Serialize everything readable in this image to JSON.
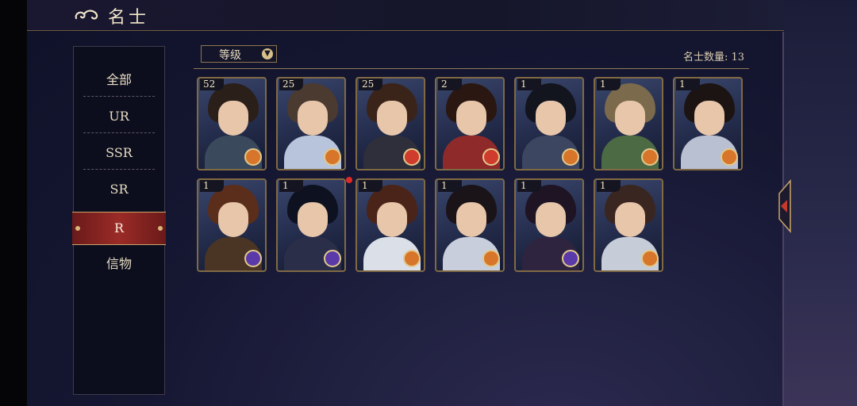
{
  "header": {
    "title": "名士"
  },
  "sidebar": {
    "items": [
      {
        "label": "全部"
      },
      {
        "label": "UR"
      },
      {
        "label": "SSR"
      },
      {
        "label": "SR"
      },
      {
        "label": "R"
      },
      {
        "label": "信物"
      }
    ],
    "active": "R"
  },
  "toolbar": {
    "sort_label": "等级",
    "count_text": "名士数量: 13"
  },
  "cards": [
    {
      "level": "52",
      "badge": "orange",
      "hair": "#2b1f1a",
      "body": "#3a4a5c",
      "new": false
    },
    {
      "level": "25",
      "badge": "orange",
      "hair": "#4b3a30",
      "body": "#b7c4dc",
      "new": false
    },
    {
      "level": "25",
      "badge": "red",
      "hair": "#3a241a",
      "body": "#2e2f3a",
      "new": false
    },
    {
      "level": "2",
      "badge": "red",
      "hair": "#2b1712",
      "body": "#8f2a2a",
      "new": false
    },
    {
      "level": "1",
      "badge": "orange",
      "hair": "#12141e",
      "body": "#3c4660",
      "new": false
    },
    {
      "level": "1",
      "badge": "orange",
      "hair": "#7b6a4c",
      "body": "#4c6a44",
      "new": false
    },
    {
      "level": "1",
      "badge": "orange",
      "hair": "#1c1412",
      "body": "#b9c0d2",
      "new": false
    },
    {
      "level": "1",
      "badge": "purple",
      "hair": "#5a2e1a",
      "body": "#4a3424",
      "new": false
    },
    {
      "level": "1",
      "badge": "purple",
      "hair": "#0e1220",
      "body": "#2a2e48",
      "new": true
    },
    {
      "level": "1",
      "badge": "orange",
      "hair": "#4a2418",
      "body": "#dadfe8",
      "new": false
    },
    {
      "level": "1",
      "badge": "orange",
      "hair": "#1a1418",
      "body": "#c8cedc",
      "new": false
    },
    {
      "level": "1",
      "badge": "purple",
      "hair": "#1e1424",
      "body": "#2e2440",
      "new": false
    },
    {
      "level": "1",
      "badge": "orange",
      "hair": "#3a2620",
      "body": "#c7cdd8",
      "new": false
    }
  ],
  "colors": {
    "badge_orange": "#d7762a",
    "badge_red": "#cf3b2c",
    "badge_purple": "#5a3aa8",
    "accent_red": "#9b2b27",
    "gold": "#c9a56a"
  },
  "icons": {
    "title_icon": "cloud-swirl-icon",
    "sort_icon": "chevron-down-icon",
    "side_tab_icon": "arrow-left-icon"
  }
}
